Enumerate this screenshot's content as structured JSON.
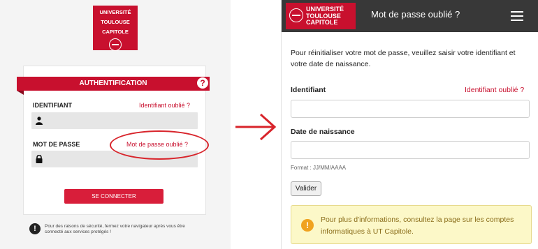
{
  "left": {
    "logo": {
      "line1": "UNIVERSITÉ",
      "line2": "TOULOUSE",
      "line3": "CAPITOLE"
    },
    "ribbon_title": "AUTHENTIFICATION",
    "help_label": "?",
    "identifiant_label": "IDENTIFIANT",
    "identifiant_link": "Identifiant oublié ?",
    "password_label": "MOT DE PASSE",
    "password_link": "Mot de passe oublié ?",
    "connect_button": "SE CONNECTER",
    "warning_icon": "!",
    "warning_text": "Pour des raisons de sécurité, fermez votre navigateur après vous être connecté aux services protégés !"
  },
  "right": {
    "logo": {
      "line1": "UNIVERSITÉ",
      "line2": "TOULOUSE",
      "line3": "CAPITOLE"
    },
    "title": "Mot de passe oublié ?",
    "intro": "Pour réinitialiser votre mot de passe, veuillez saisir votre identifiant et votre date de naissance.",
    "identifiant_label": "Identifiant",
    "identifiant_link": "Identifiant oublié ?",
    "identifiant_value": "",
    "birthdate_label": "Date de naissance",
    "birthdate_value": "",
    "format_hint": "Format : JJ/MM/AAAA",
    "submit_button": "Valider",
    "info_icon": "!",
    "info_prefix": "Pour plus d'informations, ",
    "info_link": "consultez la page sur les comptes informatiques à UT Capitole",
    "info_suffix": "."
  },
  "colors": {
    "brand": "#c8102e",
    "annotation": "#d8242b",
    "topbar": "#383838",
    "info_bg": "#fcf8c8"
  },
  "icons": [
    "user-icon",
    "lock-icon",
    "help-icon",
    "warning-icon",
    "menu-icon",
    "info-icon",
    "arrow-right-icon"
  ]
}
